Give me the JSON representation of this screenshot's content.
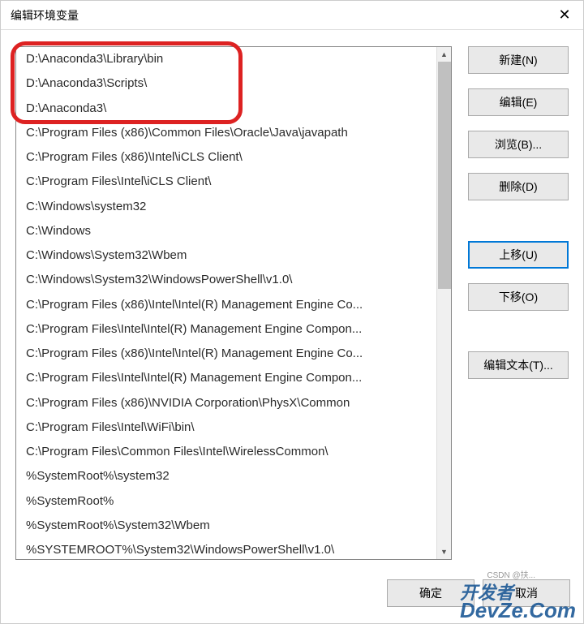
{
  "window": {
    "title": "编辑环境变量",
    "close_glyph": "✕"
  },
  "list": {
    "items": [
      "D:\\Anaconda3\\Library\\bin",
      "D:\\Anaconda3\\Scripts\\",
      "D:\\Anaconda3\\",
      "C:\\Program Files (x86)\\Common Files\\Oracle\\Java\\javapath",
      "C:\\Program Files (x86)\\Intel\\iCLS Client\\",
      "C:\\Program Files\\Intel\\iCLS Client\\",
      "C:\\Windows\\system32",
      "C:\\Windows",
      "C:\\Windows\\System32\\Wbem",
      "C:\\Windows\\System32\\WindowsPowerShell\\v1.0\\",
      "C:\\Program Files (x86)\\Intel\\Intel(R) Management Engine Co...",
      "C:\\Program Files\\Intel\\Intel(R) Management Engine Compon...",
      "C:\\Program Files (x86)\\Intel\\Intel(R) Management Engine Co...",
      "C:\\Program Files\\Intel\\Intel(R) Management Engine Compon...",
      "C:\\Program Files (x86)\\NVIDIA Corporation\\PhysX\\Common",
      "C:\\Program Files\\Intel\\WiFi\\bin\\",
      "C:\\Program Files\\Common Files\\Intel\\WirelessCommon\\",
      "%SystemRoot%\\system32",
      "%SystemRoot%",
      "%SystemRoot%\\System32\\Wbem",
      "%SYSTEMROOT%\\System32\\WindowsPowerShell\\v1.0\\"
    ]
  },
  "buttons": {
    "new": "新建(N)",
    "edit": "编辑(E)",
    "browse": "浏览(B)...",
    "delete": "删除(D)",
    "move_up": "上移(U)",
    "move_down": "下移(O)",
    "edit_text": "编辑文本(T)...",
    "ok": "确定",
    "cancel": "取消"
  },
  "scroll": {
    "up_glyph": "▲",
    "down_glyph": "▼"
  },
  "watermark": {
    "line1": "开发者",
    "line2": "DevZe.Com",
    "small": "CSDN @扶..."
  }
}
